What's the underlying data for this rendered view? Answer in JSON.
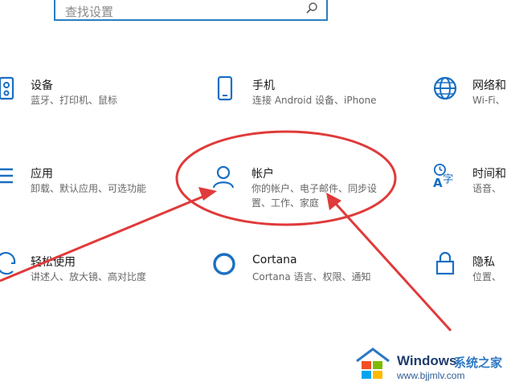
{
  "search": {
    "placeholder": "查找设置",
    "icon": "search-icon"
  },
  "tiles": [
    {
      "id": "devices",
      "title": "设备",
      "lines": [
        "蓝牙、打印机、鼠标"
      ],
      "icon": "devices-icon"
    },
    {
      "id": "phone",
      "title": "手机",
      "lines": [
        "连接 Android 设备、iPhone"
      ],
      "icon": "phone-icon"
    },
    {
      "id": "network",
      "title": "网络和",
      "lines": [
        "Wi-Fi、"
      ],
      "icon": "globe-icon"
    },
    {
      "id": "apps",
      "title": "应用",
      "lines": [
        "卸载、默认应用、可选功能"
      ],
      "icon": "apps-list-icon"
    },
    {
      "id": "accounts",
      "title": "帐户",
      "lines": [
        "你的帐户、电子邮件、同步设",
        "置、工作、家庭"
      ],
      "icon": "person-icon"
    },
    {
      "id": "time",
      "title": "时间和",
      "lines": [
        "语音、"
      ],
      "icon": "time-language-icon"
    },
    {
      "id": "ease",
      "title": "轻松使用",
      "lines": [
        "讲述人、放大镜、高对比度"
      ],
      "icon": "ease-of-access-icon"
    },
    {
      "id": "cortana",
      "title": "Cortana",
      "lines": [
        "Cortana 语言、权限、通知"
      ],
      "icon": "cortana-ring-icon"
    },
    {
      "id": "privacy",
      "title": "隐私",
      "lines": [
        "位置、"
      ],
      "icon": "lock-icon"
    }
  ],
  "watermark": {
    "brand": "Windows",
    "tagline": "系统之家",
    "url": "www.bjjmlv.com",
    "icon": "windows-logo-icon"
  },
  "colors": {
    "accent": "#1a6fc2",
    "annotation": "#e03a3a",
    "search_border": "#2b7ec1"
  }
}
